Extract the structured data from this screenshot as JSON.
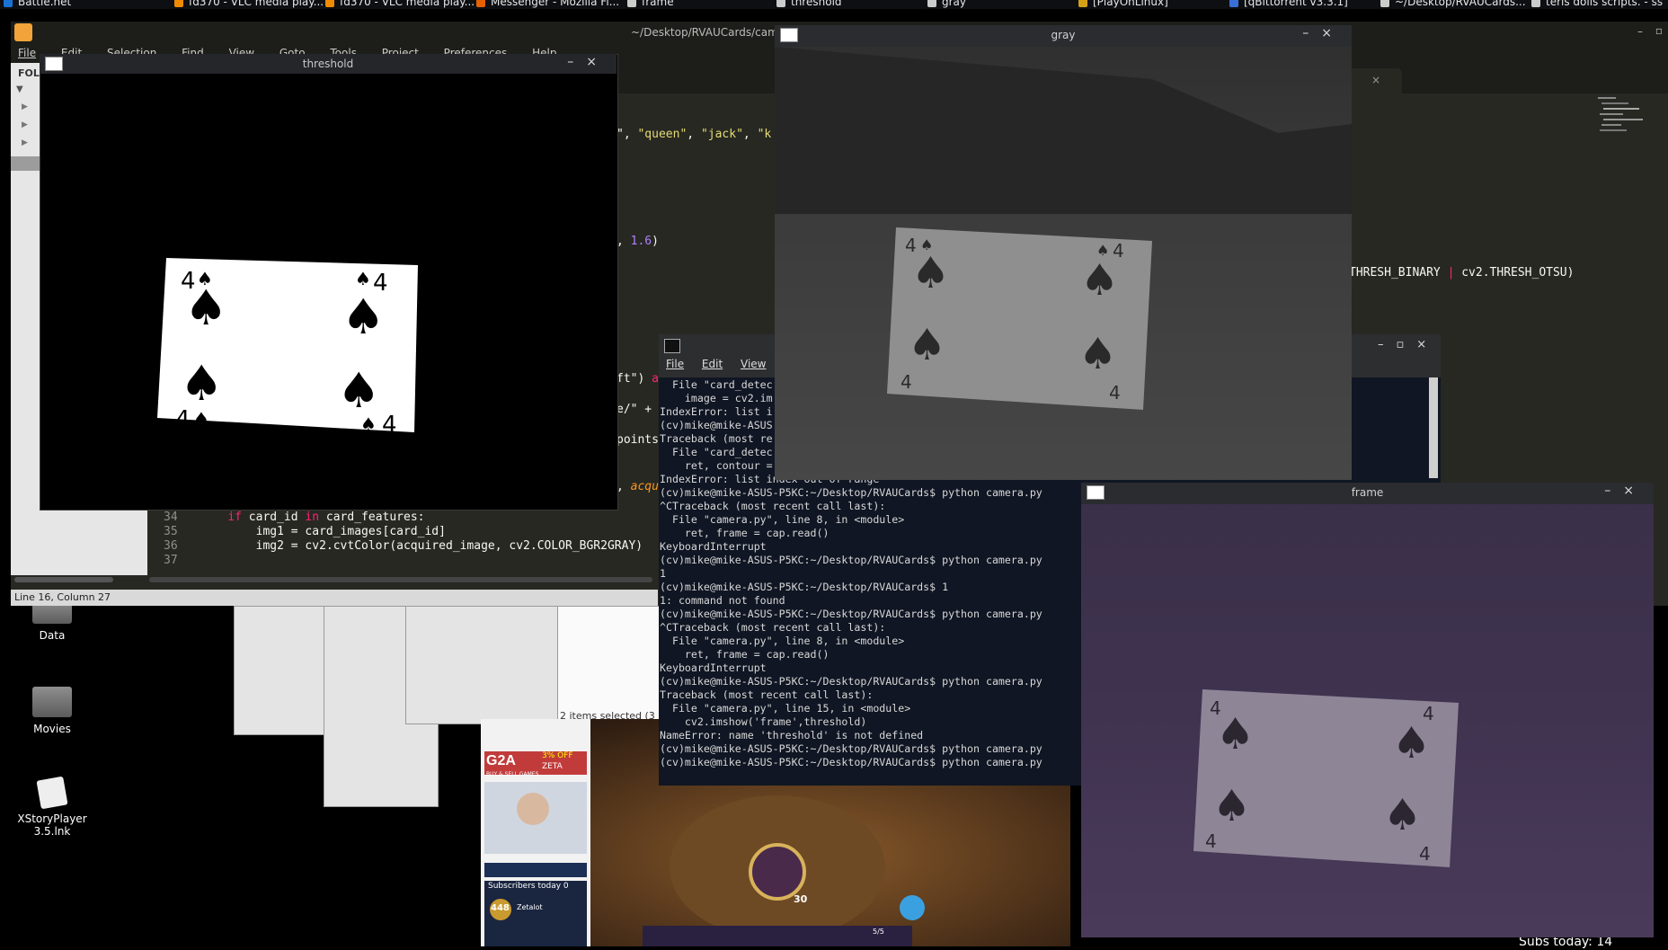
{
  "taskbar": {
    "items": [
      {
        "label": "Battle.net",
        "color": "#1a73d4"
      },
      {
        "label": "fd370 - VLC media play...",
        "color": "#f08a00"
      },
      {
        "label": "fd370 - VLC media play...",
        "color": "#f08a00"
      },
      {
        "label": "Messenger - Mozilla Fi...",
        "color": "#e66000"
      },
      {
        "label": "frame",
        "color": "#cccccc"
      },
      {
        "label": "threshold",
        "color": "#cccccc"
      },
      {
        "label": "gray",
        "color": "#cccccc"
      },
      {
        "label": "[PlayOnLinux]",
        "color": "#d4a017"
      },
      {
        "label": "[qBittorrent v3.3.1]",
        "color": "#3a6fd8"
      },
      {
        "label": "~/Desktop/RVAUCards...",
        "color": "#cccccc"
      },
      {
        "label": "terls dolls scripts. - ss",
        "color": "#cccccc"
      }
    ]
  },
  "editor": {
    "title": "~/Desktop/RVAUCards/came",
    "menu": [
      "File",
      "Edit",
      "Selection",
      "Find",
      "View",
      "Goto",
      "Tools",
      "Project",
      "Preferences",
      "Help"
    ],
    "sidebar_header": "FOL",
    "status": "Line 16, Column 27",
    "tab_close": "×",
    "code_fragments": {
      "l1a": "\", ",
      "l1b": "\"queen\"",
      "l1c": ", ",
      "l1d": "\"jack\"",
      "l1e": ", ",
      "l1f": "\"k",
      "l2a": ", ",
      "l2b": "1.6",
      "l2c": ")",
      "l3a": "THRESH_BINARY ",
      "l3b": "|",
      "l3c": " cv2.THRESH_OTSU)",
      "l4a": "ft\") ",
      "l4b": "a",
      "l5a": "e/\" + ",
      "l6a": "points(",
      "l7a": ", ",
      "l7b": "acqu"
    },
    "lines": [
      {
        "num": "34",
        "indent": "    ",
        "kw": "if",
        "pre": " card_id ",
        "kw2": "in",
        "post": " card_features:"
      },
      {
        "num": "35",
        "indent": "        ",
        "text": "img1 = card_images[card_id]"
      },
      {
        "num": "36",
        "indent": "        ",
        "text": "img2 = cv2.cvtColor(acquired_image, cv2.COLOR_BGR2GRAY)"
      },
      {
        "num": "37",
        "indent": "",
        "text": ""
      }
    ]
  },
  "desktop": {
    "icons": [
      {
        "label": "Data"
      },
      {
        "label": "Movies"
      },
      {
        "label": "XStoryPlayer 3.5.lnk"
      }
    ]
  },
  "file_manager": {
    "status": "2 items selected (3"
  },
  "windows": {
    "threshold": {
      "title": "threshold",
      "buttons": "–×"
    },
    "gray": {
      "title": "gray",
      "buttons": "–×"
    },
    "frame": {
      "title": "frame",
      "buttons": "–×"
    },
    "terminal": {
      "menu": [
        "File",
        "Edit",
        "View",
        "T"
      ],
      "buttons": "–▫×",
      "lines": [
        "  File \"card_detec",
        "    image = cv2.im",
        "IndexError: list i",
        "(cv)mike@mike-ASUS",
        "Traceback (most re",
        "  File \"card_detec",
        "    ret, contour =",
        "IndexError: list index out of range",
        "(cv)mike@mike-ASUS-P5KC:~/Desktop/RVAUCards$ python camera.py",
        "^CTraceback (most recent call last):",
        "  File \"camera.py\", line 8, in <module>",
        "    ret, frame = cap.read()",
        "KeyboardInterrupt",
        "(cv)mike@mike-ASUS-P5KC:~/Desktop/RVAUCards$ python camera.py",
        "1",
        "(cv)mike@mike-ASUS-P5KC:~/Desktop/RVAUCards$ 1",
        "1: command not found",
        "(cv)mike@mike-ASUS-P5KC:~/Desktop/RVAUCards$ python camera.py",
        "^CTraceback (most recent call last):",
        "  File \"camera.py\", line 8, in <module>",
        "    ret, frame = cap.read()",
        "KeyboardInterrupt",
        "(cv)mike@mike-ASUS-P5KC:~/Desktop/RVAUCards$ python camera.py",
        "Traceback (most recent call last):",
        "  File \"camera.py\", line 15, in <module>",
        "    cv2.imshow('frame',threshold)",
        "NameError: name 'threshold' is not defined",
        "(cv)mike@mike-ASUS-P5KC:~/Desktop/RVAUCards$ python camera.py",
        "(cv)mike@mike-ASUS-P5KC:~/Desktop/RVAUCards$ python camera.py"
      ]
    }
  },
  "card": {
    "rank": "4",
    "suit": "♠"
  },
  "stream": {
    "g2a": "G2A",
    "promo": "3% OFF",
    "zeta": "ZETA",
    "buy": "BUY & SELL GAMES",
    "subs": "Subscribers today 0",
    "count": "448",
    "name": "Zetalot",
    "hp": "30",
    "mana": "5/5",
    "subs_right": "Subs today: 14"
  }
}
